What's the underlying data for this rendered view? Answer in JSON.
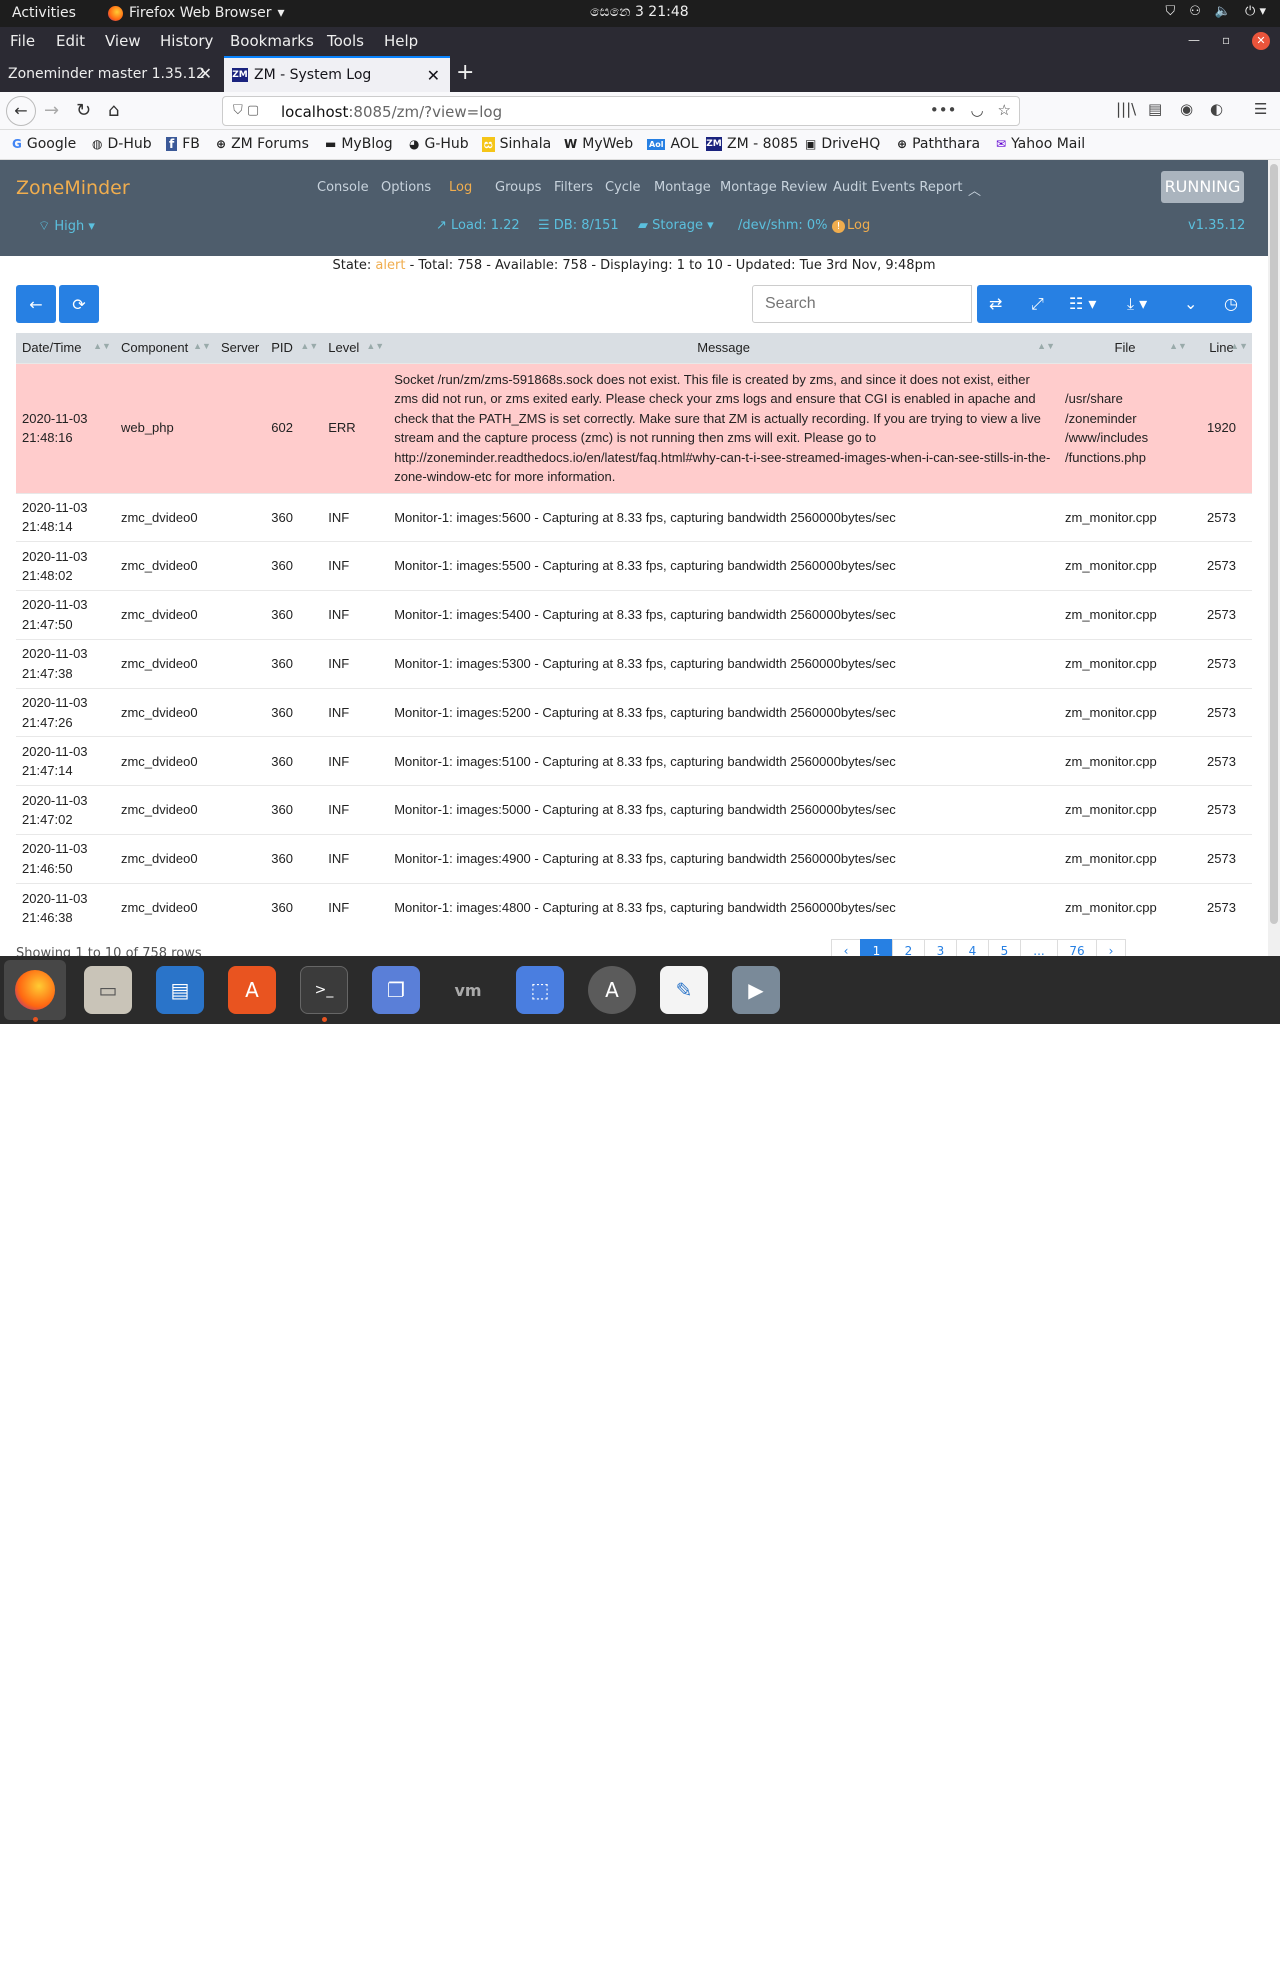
{
  "gnome": {
    "activities": "Activities",
    "app": "Firefox Web Browser",
    "clock": "සෙනෙ 3  21:48"
  },
  "menubar": [
    "File",
    "Edit",
    "View",
    "History",
    "Bookmarks",
    "Tools",
    "Help"
  ],
  "tabs": [
    {
      "label": "Zoneminder master 1.35.12"
    },
    {
      "label": "ZM - System Log"
    }
  ],
  "url": {
    "host": "localhost",
    "rest": ":8085/zm/?view=log"
  },
  "bookmarks": [
    "Google",
    "D-Hub",
    "FB",
    "ZM Forums",
    "MyBlog",
    "G-Hub",
    "Sinhala",
    "MyWeb",
    "AOL",
    "ZM - 8085",
    "DriveHQ",
    "Paththara",
    "Yahoo Mail"
  ],
  "zm": {
    "brand": "ZoneMinder",
    "nav": [
      "Console",
      "Options",
      "Log",
      "Groups",
      "Filters",
      "Cycle",
      "Montage",
      "Montage Review",
      "Audit Events Report"
    ],
    "running": "RUNNING",
    "bandwidth": "High",
    "load": "Load: 1.22",
    "db": "DB: 8/151",
    "storage": "Storage",
    "shm": "/dev/shm: 0%",
    "log": "Log",
    "version": "v1.35.12"
  },
  "state": {
    "prefix": "State:",
    "value": "alert",
    "rest": " -  Total: 758 -  Available: 758 -  Displaying: 1 to 10 -  Updated: Tue 3rd Nov, 9:48pm"
  },
  "search_placeholder": "Search",
  "columns": [
    "Date/Time",
    "Component",
    "Server",
    "PID",
    "Level",
    "Message",
    "File",
    "Line"
  ],
  "rows": [
    {
      "date": "2020-11-03",
      "time": "21:48:16",
      "component": "web_php",
      "server": "",
      "pid": "602",
      "level": "ERR",
      "message": "Socket /run/zm/zms-591868s.sock does not exist. This file is created by zms, and since it does not exist, either zms did not run, or zms exited early. Please check your zms logs and ensure that CGI is enabled in apache and check that the PATH_ZMS is set correctly. Make sure that ZM is actually recording. If you are trying to view a live stream and the capture process (zmc) is not running then zms will exit. Please go to http://zoneminder.readthedocs.io/en/latest/faq.html#why-can-t-i-see-streamed-images-when-i-can-see-stills-in-the-zone-window-etc for more information.",
      "file": "/usr/share /zoneminder /www/includes /functions.php",
      "line": "1920"
    },
    {
      "date": "2020-11-03",
      "time": "21:48:14",
      "component": "zmc_dvideo0",
      "server": "",
      "pid": "360",
      "level": "INF",
      "message": "Monitor-1: images:5600 - Capturing at 8.33 fps, capturing bandwidth 2560000bytes/sec",
      "file": "zm_monitor.cpp",
      "line": "2573"
    },
    {
      "date": "2020-11-03",
      "time": "21:48:02",
      "component": "zmc_dvideo0",
      "server": "",
      "pid": "360",
      "level": "INF",
      "message": "Monitor-1: images:5500 - Capturing at 8.33 fps, capturing bandwidth 2560000bytes/sec",
      "file": "zm_monitor.cpp",
      "line": "2573"
    },
    {
      "date": "2020-11-03",
      "time": "21:47:50",
      "component": "zmc_dvideo0",
      "server": "",
      "pid": "360",
      "level": "INF",
      "message": "Monitor-1: images:5400 - Capturing at 8.33 fps, capturing bandwidth 2560000bytes/sec",
      "file": "zm_monitor.cpp",
      "line": "2573"
    },
    {
      "date": "2020-11-03",
      "time": "21:47:38",
      "component": "zmc_dvideo0",
      "server": "",
      "pid": "360",
      "level": "INF",
      "message": "Monitor-1: images:5300 - Capturing at 8.33 fps, capturing bandwidth 2560000bytes/sec",
      "file": "zm_monitor.cpp",
      "line": "2573"
    },
    {
      "date": "2020-11-03",
      "time": "21:47:26",
      "component": "zmc_dvideo0",
      "server": "",
      "pid": "360",
      "level": "INF",
      "message": "Monitor-1: images:5200 - Capturing at 8.33 fps, capturing bandwidth 2560000bytes/sec",
      "file": "zm_monitor.cpp",
      "line": "2573"
    },
    {
      "date": "2020-11-03",
      "time": "21:47:14",
      "component": "zmc_dvideo0",
      "server": "",
      "pid": "360",
      "level": "INF",
      "message": "Monitor-1: images:5100 - Capturing at 8.33 fps, capturing bandwidth 2560000bytes/sec",
      "file": "zm_monitor.cpp",
      "line": "2573"
    },
    {
      "date": "2020-11-03",
      "time": "21:47:02",
      "component": "zmc_dvideo0",
      "server": "",
      "pid": "360",
      "level": "INF",
      "message": "Monitor-1: images:5000 - Capturing at 8.33 fps, capturing bandwidth 2560000bytes/sec",
      "file": "zm_monitor.cpp",
      "line": "2573"
    },
    {
      "date": "2020-11-03",
      "time": "21:46:50",
      "component": "zmc_dvideo0",
      "server": "",
      "pid": "360",
      "level": "INF",
      "message": "Monitor-1: images:4900 - Capturing at 8.33 fps, capturing bandwidth 2560000bytes/sec",
      "file": "zm_monitor.cpp",
      "line": "2573"
    },
    {
      "date": "2020-11-03",
      "time": "21:46:38",
      "component": "zmc_dvideo0",
      "server": "",
      "pid": "360",
      "level": "INF",
      "message": "Monitor-1: images:4800 - Capturing at 8.33 fps, capturing bandwidth 2560000bytes/sec",
      "file": "zm_monitor.cpp",
      "line": "2573"
    }
  ],
  "footer": {
    "text": "Showing 1 to 10 of 758 rows",
    "pages": [
      "‹",
      "1",
      "2",
      "3",
      "4",
      "5",
      "...",
      "76",
      "›"
    ]
  },
  "colors": {
    "header": "#4e5d6c",
    "brand": "#f0ad4e",
    "primary": "#2780e3",
    "err_row": "#ffcccc"
  }
}
